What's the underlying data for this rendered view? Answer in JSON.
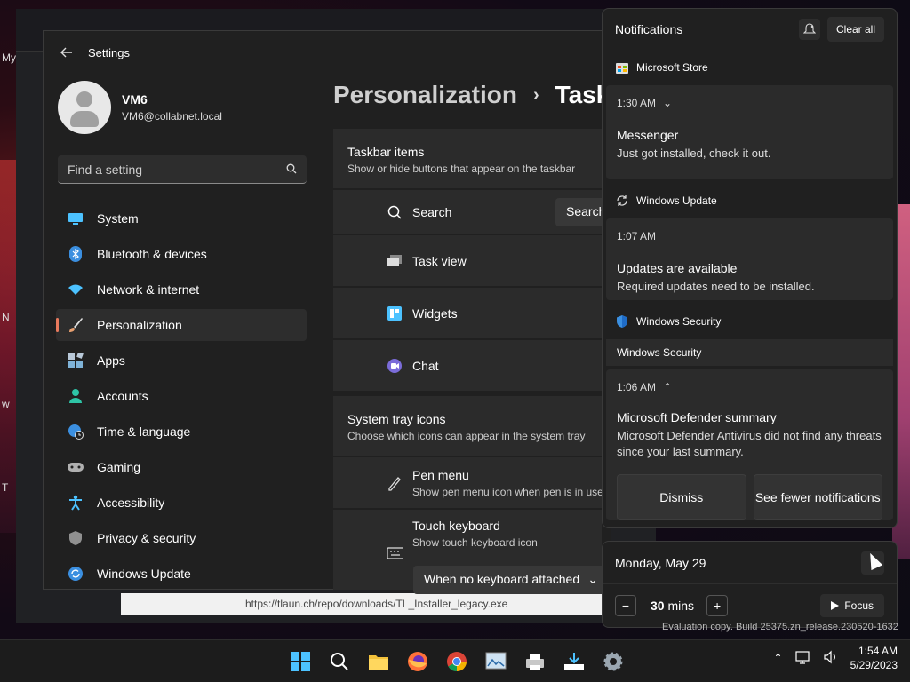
{
  "desktop": {
    "label1": "My",
    "label2": "N",
    "label3": "w",
    "label4": "T"
  },
  "browser": {
    "status_url": "https://tlaun.ch/repo/downloads/TL_Installer_legacy.exe"
  },
  "settings": {
    "title": "Settings",
    "user": {
      "name": "VM6",
      "email": "VM6@collabnet.local"
    },
    "search_placeholder": "Find a setting",
    "nav": [
      {
        "label": "System",
        "icon": "monitor-icon",
        "color": "#4cc2ff"
      },
      {
        "label": "Bluetooth & devices",
        "icon": "bluetooth-icon",
        "color": "#3b8fe0"
      },
      {
        "label": "Network & internet",
        "icon": "wifi-icon",
        "color": "#4cc2ff"
      },
      {
        "label": "Personalization",
        "icon": "brush-icon",
        "color": "#e8a070"
      },
      {
        "label": "Apps",
        "icon": "apps-icon",
        "color": "#7fb3d8"
      },
      {
        "label": "Accounts",
        "icon": "person-icon",
        "color": "#2ec4a6"
      },
      {
        "label": "Time & language",
        "icon": "globe-clock-icon",
        "color": "#3b8fe0"
      },
      {
        "label": "Gaming",
        "icon": "gamepad-icon",
        "color": "#b0b0b0"
      },
      {
        "label": "Accessibility",
        "icon": "accessibility-icon",
        "color": "#4cc2ff"
      },
      {
        "label": "Privacy & security",
        "icon": "shield-icon",
        "color": "#909090"
      },
      {
        "label": "Windows Update",
        "icon": "update-icon",
        "color": "#3b8fe0"
      }
    ],
    "breadcrumb": {
      "parent": "Personalization",
      "current": "Taskbar"
    },
    "taskbar_items": {
      "title": "Taskbar items",
      "subtitle": "Show or hide buttons that appear on the taskbar",
      "rows": [
        {
          "label": "Search",
          "value": "Search"
        },
        {
          "label": "Task view"
        },
        {
          "label": "Widgets"
        },
        {
          "label": "Chat"
        }
      ]
    },
    "tray_icons": {
      "title": "System tray icons",
      "subtitle": "Choose which icons can appear in the system tray",
      "pen_title": "Pen menu",
      "pen_sub": "Show pen menu icon when pen is in use",
      "touch_title": "Touch keyboard",
      "touch_sub": "Show touch keyboard icon",
      "touch_value": "When no keyboard attached"
    }
  },
  "notifications": {
    "title": "Notifications",
    "clear_all": "Clear all",
    "groups": [
      {
        "app": "Microsoft Store",
        "time": "1:30 AM",
        "title": "Messenger",
        "body": "Just got installed, check it out."
      },
      {
        "app": "Windows Update",
        "time": "1:07 AM",
        "title": "Updates are available",
        "body": "Required updates need to be installed."
      },
      {
        "app": "Windows Security",
        "sub_app": "Windows Security",
        "time": "1:06 AM",
        "title": "Microsoft Defender summary",
        "body": "Microsoft Defender Antivirus did not find any threats since your last summary.",
        "dismiss": "Dismiss",
        "fewer": "See fewer notifications"
      }
    ]
  },
  "calendar": {
    "date": "Monday, May 29",
    "focus_value": "30",
    "focus_unit": "mins",
    "focus_label": "Focus"
  },
  "watermark": "Evaluation copy. Build 25375.zn_release.230520-1632",
  "taskbar": {
    "time": "1:54 AM",
    "date": "5/29/2023"
  }
}
